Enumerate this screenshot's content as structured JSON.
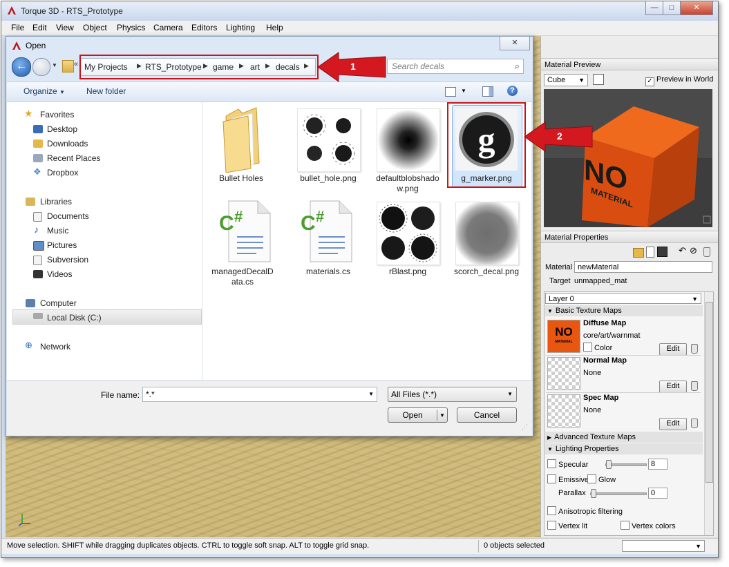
{
  "app": {
    "title": "Torque 3D - RTS_Prototype",
    "window_buttons": [
      "—",
      "□",
      "✕"
    ]
  },
  "menu": [
    "File",
    "Edit",
    "View",
    "Object",
    "Physics",
    "Camera",
    "Editors",
    "Lighting",
    "Help"
  ],
  "dialog": {
    "title": "Open",
    "close_label": "✕",
    "breadcrumb": [
      "My Projects",
      "RTS_Prototype",
      "game",
      "art",
      "decals"
    ],
    "search_placeholder": "Search decals",
    "organize_label": "Organize",
    "new_folder_label": "New folder",
    "nav": {
      "favorites_label": "Favorites",
      "favorites": [
        "Desktop",
        "Downloads",
        "Recent Places",
        "Dropbox"
      ],
      "libraries_label": "Libraries",
      "libraries": [
        "Documents",
        "Music",
        "Pictures",
        "Subversion",
        "Videos"
      ],
      "computer_label": "Computer",
      "computer": [
        "Local Disk (C:)"
      ],
      "network_label": "Network"
    },
    "files": [
      {
        "name": "Bullet Holes",
        "kind": "folder"
      },
      {
        "name": "bullet_hole.png",
        "kind": "holes"
      },
      {
        "name": "defaultblobshadow.png",
        "kind": "blob"
      },
      {
        "name": "g_marker.png",
        "kind": "gmarker",
        "selected": true
      },
      {
        "name": "managedDecalData.cs",
        "kind": "cs"
      },
      {
        "name": "materials.cs",
        "kind": "cs"
      },
      {
        "name": "rBlast.png",
        "kind": "blast"
      },
      {
        "name": "scorch_decal.png",
        "kind": "scorch"
      }
    ],
    "filename_label": "File name:",
    "filename_value": "*.*",
    "filetype_value": "All Files (*.*)",
    "open_label": "Open",
    "cancel_label": "Cancel"
  },
  "callouts": [
    {
      "number": "1"
    },
    {
      "number": "2"
    }
  ],
  "right_panel": {
    "material_preview_label": "Material Preview",
    "preview_shape": "Cube",
    "preview_in_world_label": "Preview in World",
    "cube_text": "NO",
    "cube_subtext": "MATERIAL",
    "material_properties_label": "Material Properties",
    "material_label": "Material",
    "material_value": "newMaterial",
    "target_label": "Target",
    "target_value": "unmapped_mat",
    "layer_value": "Layer 0",
    "basic_texture_maps_label": "Basic Texture Maps",
    "diffuse_map_label": "Diffuse Map",
    "diffuse_map_value": "core/art/warnmat",
    "color_label": "Color",
    "normal_map_label": "Normal Map",
    "normal_map_value": "None",
    "spec_map_label": "Spec Map",
    "spec_map_value": "None",
    "edit_label": "Edit",
    "advanced_texture_maps_label": "Advanced Texture Maps",
    "lighting_properties_label": "Lighting Properties",
    "specular_label": "Specular",
    "specular_value": "8",
    "emissive_label": "Emissive",
    "glow_label": "Glow",
    "parallax_label": "Parallax",
    "parallax_value": "0",
    "anisotropic_label": "Anisotropic filtering",
    "vertex_lit_label": "Vertex lit",
    "vertex_colors_label": "Vertex colors"
  },
  "status": {
    "hint": "Move selection.  SHIFT while dragging duplicates objects.  CTRL to toggle soft snap.  ALT to toggle grid snap.",
    "selection": "0 objects selected"
  },
  "colors": {
    "accent_red": "#c8141a",
    "cube_orange": "#e8560f"
  }
}
